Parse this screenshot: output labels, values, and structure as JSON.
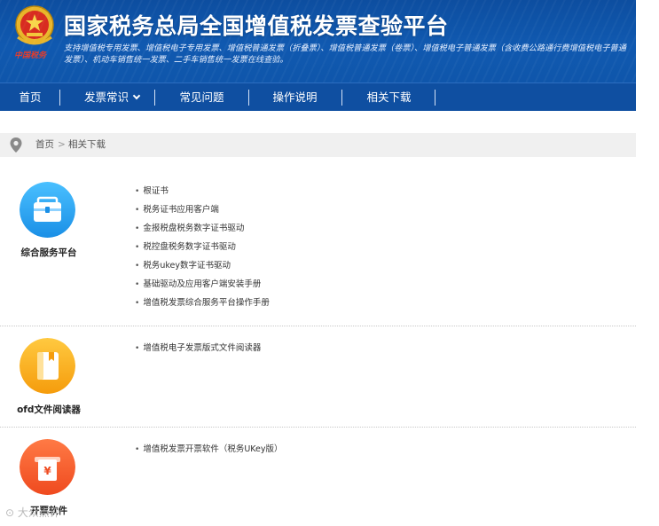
{
  "header": {
    "title": "国家税务总局全国增值税发票查验平台",
    "subtitle": "支持增值税专用发票、增值税电子专用发票、增值税普通发票（折叠票）、增值税普通发票（卷票）、增值税电子普通发票（含收费公路通行费增值税电子普通发票）、机动车销售统一发票、二手车销售统一发票在线查验。",
    "brand_script": "中国税务"
  },
  "nav": {
    "items": [
      {
        "label": "首页"
      },
      {
        "label": "发票常识",
        "has_dropdown": true
      },
      {
        "label": "常见问题"
      },
      {
        "label": "操作说明"
      },
      {
        "label": "相关下载"
      }
    ]
  },
  "breadcrumb": {
    "home": "首页",
    "separator": ">",
    "current": "相关下载"
  },
  "categories": [
    {
      "label": "综合服务平台",
      "icon": "briefcase-icon",
      "color": "#29a3ee",
      "links": [
        "根证书",
        "税务证书应用客户端",
        "金报税盘税务数字证书驱动",
        "税控盘税务数字证书驱动",
        "税务ukey数字证书驱动",
        "基础驱动及应用客户端安装手册",
        "增值税发票综合服务平台操作手册"
      ]
    },
    {
      "label": "ofd文件阅读器",
      "icon": "book-icon",
      "color": "#f8a818",
      "links": [
        "增值税电子发票版式文件阅读器"
      ]
    },
    {
      "label": "开票软件",
      "icon": "invoice-printer-icon",
      "color": "#f25a2a",
      "links": [
        "增值税发票开票软件（税务UKey版）"
      ]
    }
  ],
  "watermark": "大众点评"
}
